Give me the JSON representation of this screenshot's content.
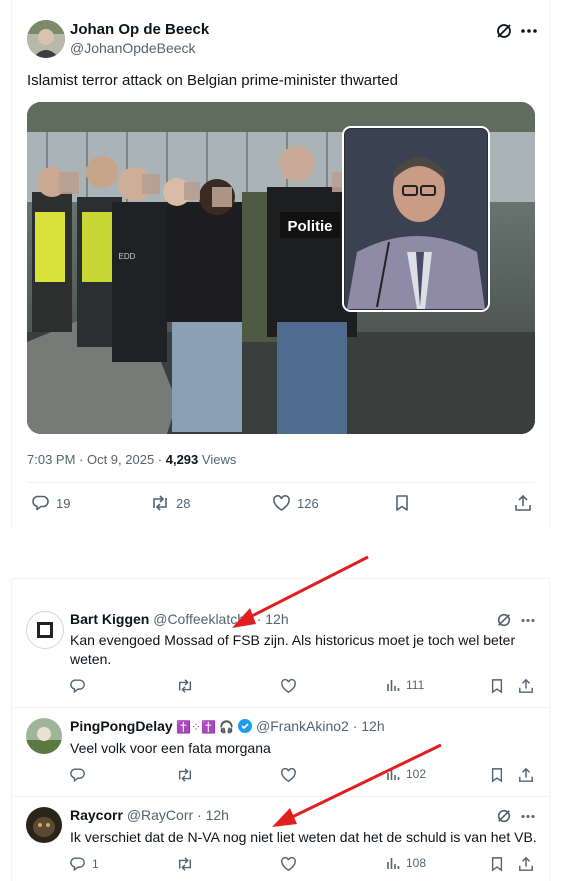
{
  "tweet": {
    "author_name": "Johan Op de Beeck",
    "author_handle": "@JohanOpdeBeeck",
    "text": "Islamist terror attack on Belgian prime-minister  thwarted",
    "image_badge_text": "Politie",
    "image_vest_text": "EDD",
    "time": "7:03 PM · Oct 9, 2025 · ",
    "views_count": "4,293",
    "views_label": " Views",
    "stats": {
      "replies": "19",
      "reposts": "28",
      "likes": "126"
    }
  },
  "replies": [
    {
      "name": "Bart Kiggen",
      "handle": "@Coffeeklatche",
      "time": " · 12h",
      "text": "Kan evengoed Mossad of FSB zijn. Als historicus moet je toch wel beter weten.",
      "reply_count": "",
      "views": "111"
    },
    {
      "name": "PingPongDelay",
      "emoji": " ✝️⁘✝️ 🎧",
      "handle": "@FrankAkino2",
      "time": " · 12h",
      "text": "Veel volk voor een fata morgana",
      "reply_count": "",
      "views": "102"
    },
    {
      "name": "Raycorr",
      "handle": "@RayCorr",
      "time": " · 12h",
      "text": "Ik verschiet dat de N-VA nog niet liet weten dat het de schuld is van het VB.",
      "reply_count": "1",
      "views": "108"
    }
  ],
  "colors": {
    "text": "#0f1419",
    "muted": "#536471",
    "verified": "#1d9bf0",
    "annotation_arrow": "#e02020"
  },
  "icons": [
    "grok-icon",
    "more-icon",
    "reply-icon",
    "repost-icon",
    "like-icon",
    "bookmark-icon",
    "share-icon",
    "views-icon",
    "verified-icon"
  ]
}
